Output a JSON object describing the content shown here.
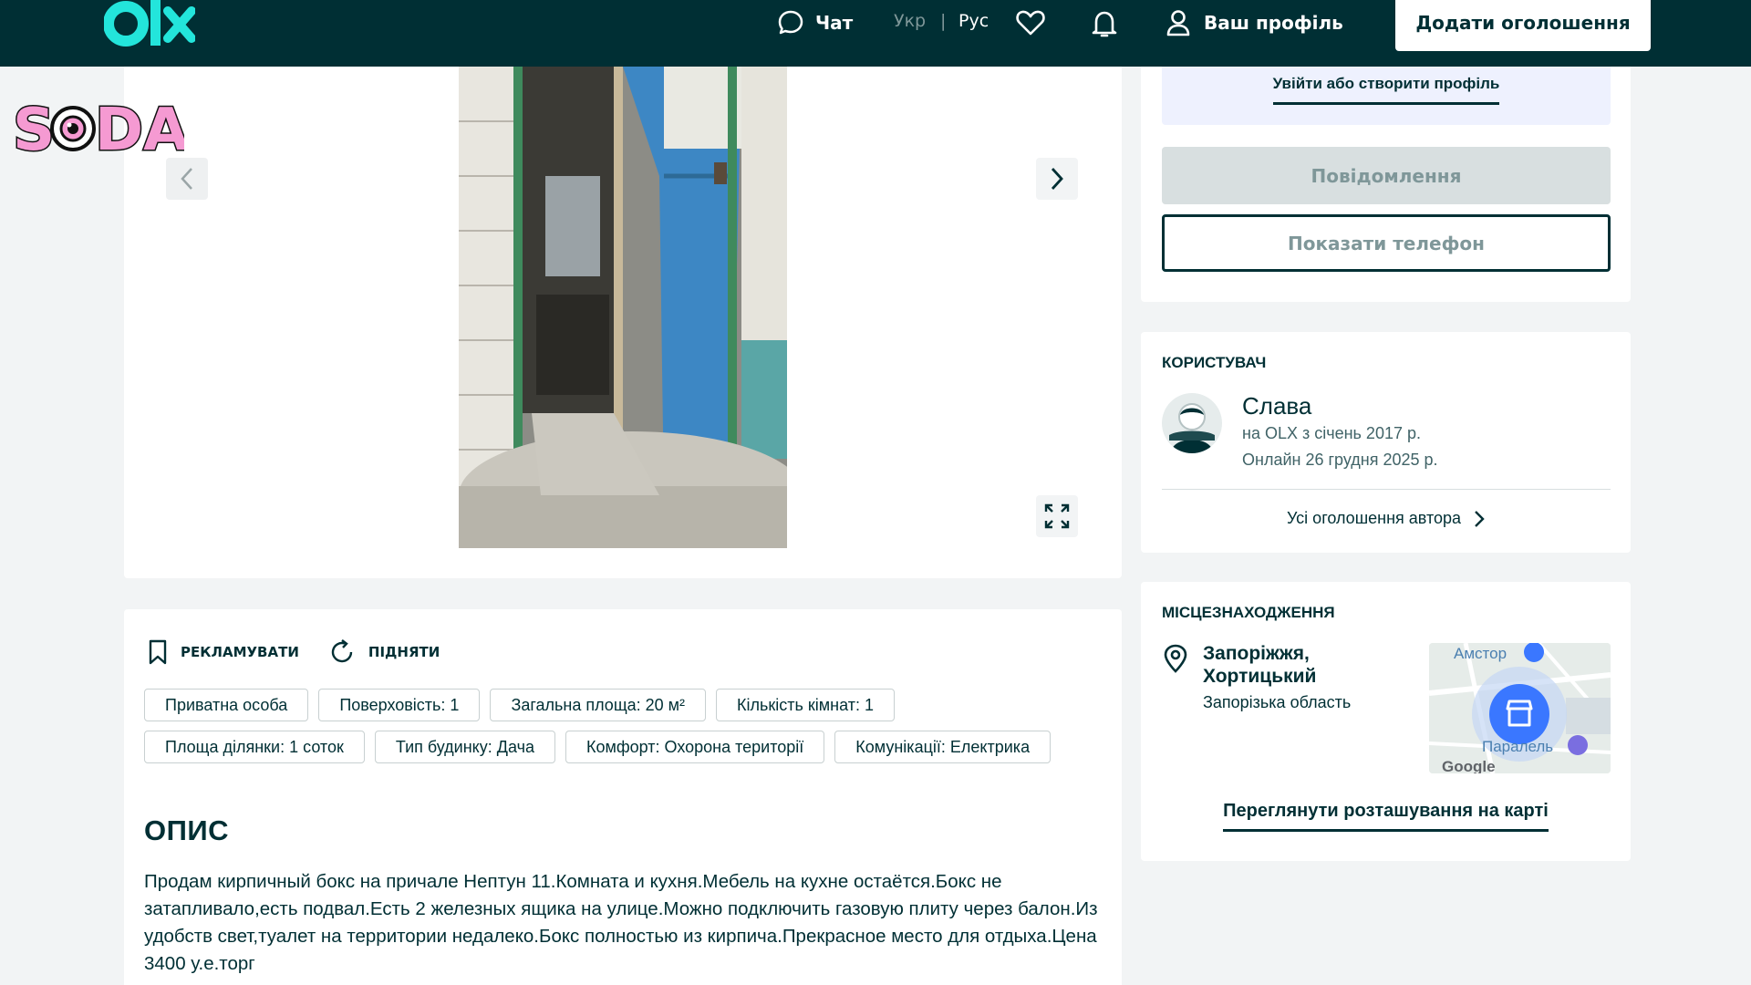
{
  "header": {
    "chat_label": "Чат",
    "lang_ukr": "Укр",
    "lang_sep": "|",
    "lang_rus": "Рус",
    "profile_label": "Ваш профіль",
    "add_ad_label": "Додати оголошення"
  },
  "watermark": {
    "text": "SODA"
  },
  "gallery": {
    "prev_icon": "chevron-left-icon",
    "next_icon": "chevron-right-icon",
    "expand_icon": "expand-icon"
  },
  "actions": {
    "promote_label": "РЕКЛАМУВАТИ",
    "raise_label": "ПІДНЯТИ"
  },
  "tags": [
    [
      "Приватна особа",
      "Поверховість: 1",
      "Загальна площа: 20 м²",
      "Кількість кімнат: 1"
    ],
    [
      "Площа ділянки: 1 соток",
      "Тип будинку: Дача",
      "Комфорт: Охорона території",
      "Комунікації: Електрика"
    ]
  ],
  "description": {
    "title": "ОПИС",
    "text": "Продам кирпичный бокс на причале Нептун 11.Комната и кухня.Мебель на кухне остаётся.Бокс не затапливало,есть подвал.Есть 2 железных ящика на улице.Можно подключить газовую плиту через балон.Из удобств свет,туалет на территории недалеко.Бокс полностью из кирпича.Прекрасное место для отдыха.Цена 3400 у.е.торг"
  },
  "contact": {
    "login_label": "Увійти або створити профіль",
    "message_label": "Повідомлення",
    "phone_label": "Показати телефон"
  },
  "user": {
    "section_title": "Користувач",
    "name": "Слава",
    "since": "на OLX з січень 2017 р.",
    "online": "Онлайн 26 грудня 2025 р.",
    "all_ads_label": "Усі оголошення автора"
  },
  "location": {
    "section_title": "Місцезнаходження",
    "city": "Запоріжжя, Хортицький",
    "region": "Запорізька область",
    "map_label_1": "Амстор",
    "map_label_2": "Паралель",
    "map_label_3": "Google",
    "map_link_label": "Переглянути розташування на карті"
  },
  "colors": {
    "header_bg": "#002f34",
    "brand_teal": "#23e5db",
    "page_bg": "#f2f4f5",
    "login_bg": "#eef1fe",
    "map_marker": "#3a77ff"
  }
}
